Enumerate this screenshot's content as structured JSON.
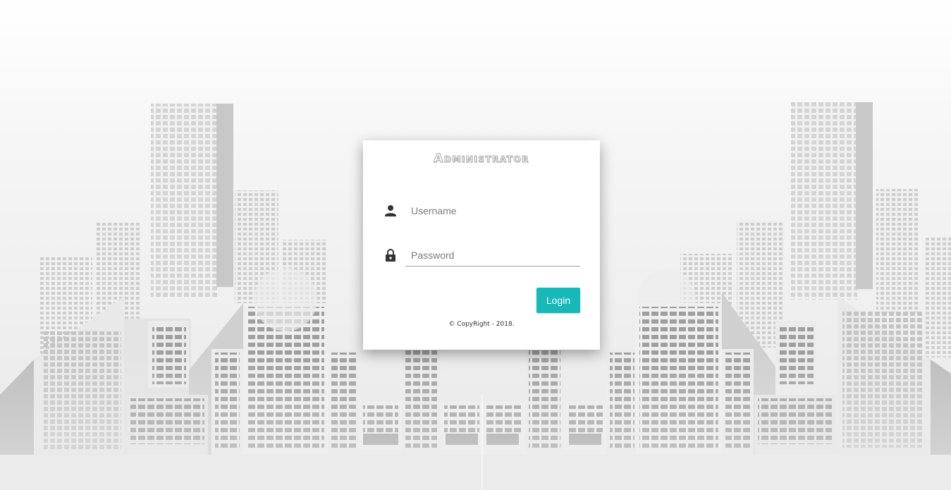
{
  "login": {
    "title": "Administrator",
    "username_placeholder": "Username",
    "password_placeholder": "Password",
    "login_label": "Login",
    "copyright": "© CopyRight - 2018."
  },
  "icons": {
    "username": "person-icon",
    "password": "lock-icon"
  },
  "colors": {
    "accent": "#17b8b8",
    "card_background": "#ffffff",
    "page_background": "#f2f2f2",
    "building_light": "#e6e6e6",
    "building_dark": "#b5b5b5"
  }
}
